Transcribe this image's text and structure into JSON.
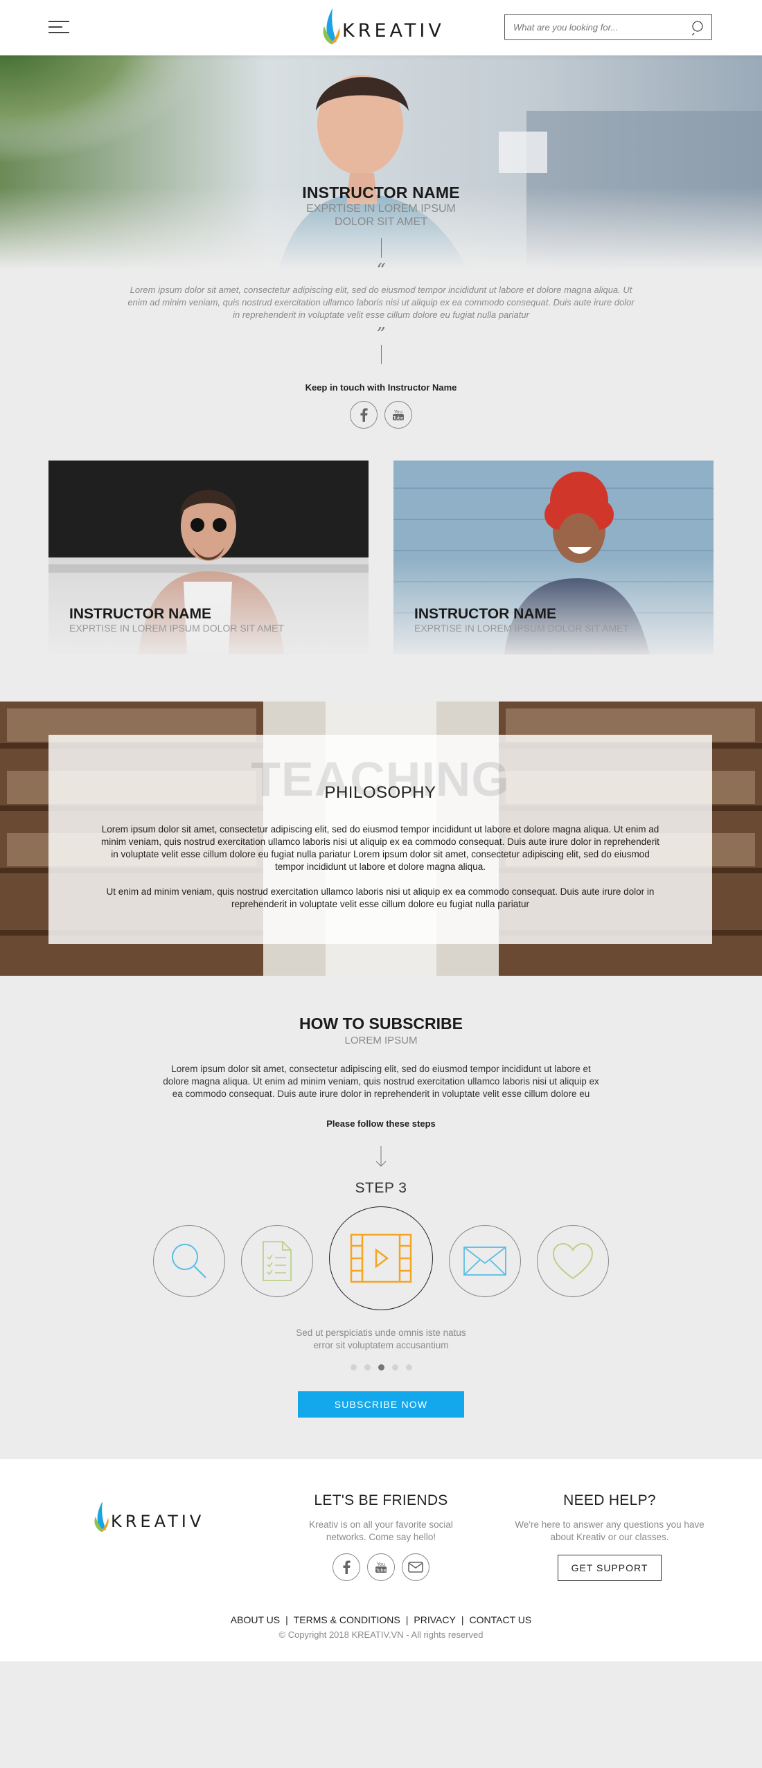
{
  "header": {
    "logo_text": "KREATIV",
    "search_placeholder": "What are you looking for..."
  },
  "featured_instructor": {
    "name": "INSTRUCTOR NAME",
    "expertise_line1": "EXPRTISE IN LOREM IPSUM",
    "expertise_line2": "DOLOR SIT AMET",
    "open_quote": "“",
    "close_quote": "”",
    "quote": "Lorem ipsum dolor sit amet, consectetur adipiscing elit, sed do eiusmod tempor incididunt ut labore et dolore magna aliqua. Ut enim ad minim veniam, quis nostrud exercitation ullamco laboris nisi ut aliquip ex ea commodo consequat. Duis aute irure dolor in reprehenderit in voluptate velit esse cillum dolore eu fugiat nulla pariatur",
    "keep_in_touch": "Keep in touch with Instructor Name",
    "social": [
      "facebook-icon",
      "youtube-icon"
    ]
  },
  "instructor_cards": [
    {
      "name": "INSTRUCTOR NAME",
      "expertise": "EXPRTISE IN LOREM IPSUM DOLOR SIT AMET"
    },
    {
      "name": "INSTRUCTOR NAME",
      "expertise": "EXPRTISE IN LOREM IPSUM DOLOR SIT AMET"
    }
  ],
  "teaching": {
    "big_word": "TEACHING",
    "small_word": "PHILOSOPHY",
    "paragraph1": "Lorem ipsum dolor sit amet, consectetur adipiscing elit, sed do eiusmod tempor incididunt ut labore et dolore magna aliqua. Ut enim ad minim veniam, quis nostrud exercitation ullamco laboris nisi ut aliquip ex ea commodo consequat. Duis aute irure dolor in reprehenderit in voluptate velit esse cillum dolore eu fugiat nulla pariatur Lorem ipsum dolor sit amet, consectetur adipiscing elit, sed do eiusmod tempor incididunt ut labore et dolore magna aliqua.",
    "paragraph2": "Ut enim ad minim veniam, quis nostrud exercitation ullamco laboris nisi ut aliquip ex ea commodo consequat. Duis aute irure dolor in reprehenderit in voluptate velit esse cillum dolore eu fugiat nulla pariatur"
  },
  "subscribe": {
    "title": "HOW TO SUBSCRIBE",
    "subtitle": "LOREM IPSUM",
    "text": "Lorem ipsum dolor sit amet, consectetur adipiscing elit, sed do eiusmod tempor incididunt ut labore et dolore magna aliqua. Ut enim ad minim veniam, quis nostrud exercitation ullamco laboris nisi ut aliquip ex ea commodo consequat. Duis aute irure dolor in reprehenderit in voluptate velit esse cillum dolore eu",
    "follow": "Please follow these steps",
    "step_title": "STEP 3",
    "steps": [
      {
        "icon": "search-icon",
        "color": "#5bbde4",
        "active": false
      },
      {
        "icon": "checklist-icon",
        "color": "#bcd08a",
        "active": false
      },
      {
        "icon": "video-icon",
        "color": "#f4a623",
        "active": true
      },
      {
        "icon": "mail-icon",
        "color": "#5bbde4",
        "active": false
      },
      {
        "icon": "heart-icon",
        "color": "#bcd08a",
        "active": false
      }
    ],
    "step_desc_line1": "Sed ut perspiciatis unde omnis iste natus",
    "step_desc_line2": "error sit voluptatem accusantium",
    "dots_total": 5,
    "dots_active": 3,
    "button": "SUBSCRIBE NOW",
    "accent_color": "#12a8eb"
  },
  "footer": {
    "logo_text": "KREATIV",
    "friends_title": "LET'S BE FRIENDS",
    "friends_text": "Kreativ is on all your favorite social networks. Come say hello!",
    "social": [
      "facebook-icon",
      "youtube-icon",
      "mail-icon"
    ],
    "help_title": "NEED HELP?",
    "help_text": "We're here to answer any questions you have about Kreativ or our classes.",
    "support_button": "GET SUPPORT",
    "links": [
      "ABOUT US",
      "TERMS & CONDITIONS",
      "PRIVACY",
      "CONTACT US"
    ],
    "copyright": "© Copyright 2018 KREATIV.VN - All rights reserved"
  }
}
